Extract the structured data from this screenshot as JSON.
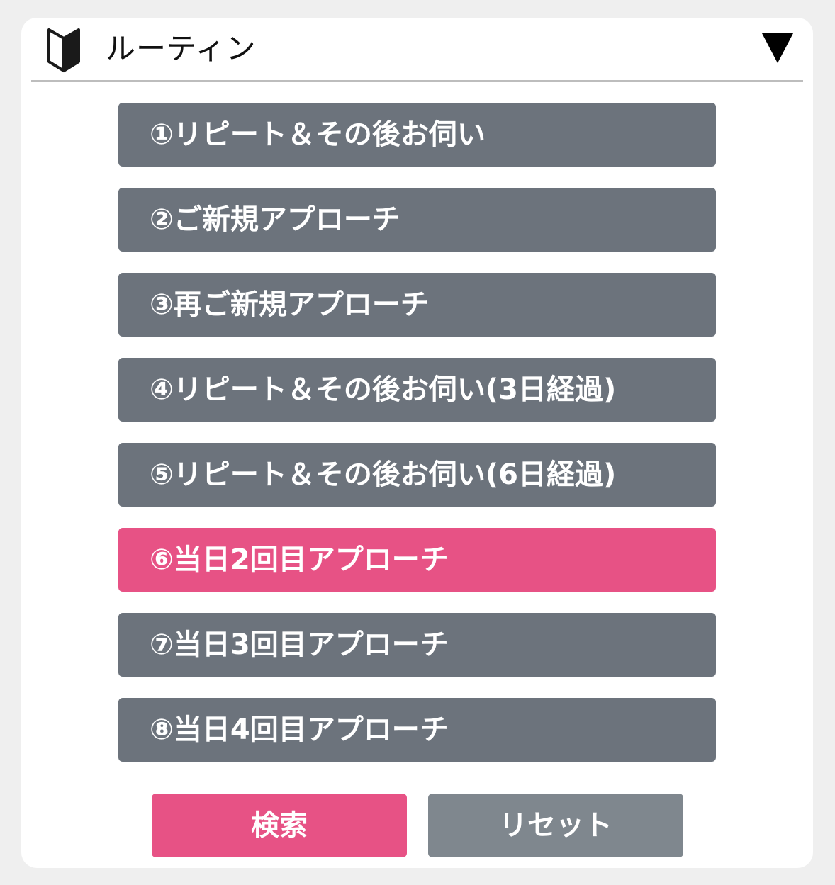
{
  "header": {
    "icon": "beginner-mark-icon",
    "title": "ルーティン",
    "toggle_icon": "triangle-down-icon"
  },
  "routines": [
    {
      "label": "①リピート＆その後お伺い",
      "selected": false
    },
    {
      "label": "②ご新規アプローチ",
      "selected": false
    },
    {
      "label": "③再ご新規アプローチ",
      "selected": false
    },
    {
      "label": "④リピート＆その後お伺い(3日経過)",
      "selected": false
    },
    {
      "label": "⑤リピート＆その後お伺い(6日経過)",
      "selected": false
    },
    {
      "label": "⑥当日2回目アプローチ",
      "selected": true
    },
    {
      "label": "⑦当日3回目アプローチ",
      "selected": false
    },
    {
      "label": "⑧当日4回目アプローチ",
      "selected": false
    }
  ],
  "actions": {
    "search_label": "検索",
    "reset_label": "リセット"
  },
  "colors": {
    "accent": "#e75285",
    "button": "#6c737c",
    "reset": "#7f878e"
  }
}
